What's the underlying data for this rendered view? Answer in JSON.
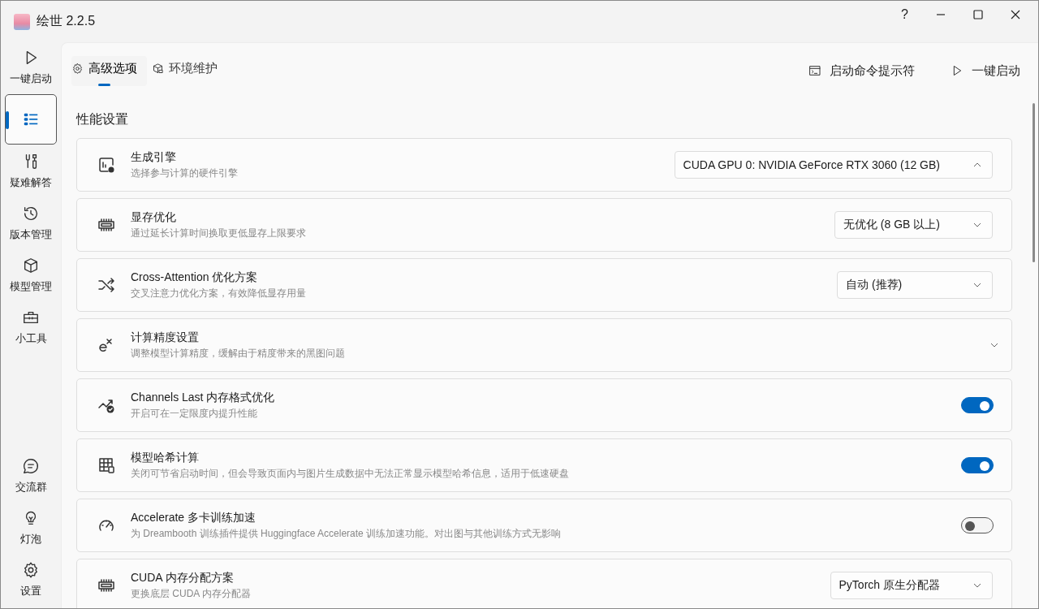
{
  "window": {
    "title": "绘世 2.2.5",
    "controls": [
      "?"
    ]
  },
  "sidebar": {
    "items": [
      {
        "label": "一键启动",
        "selected": false
      },
      {
        "selected": true
      },
      {
        "label": "疑难解答",
        "selected": false
      },
      {
        "label": "版本管理",
        "selected": false
      },
      {
        "label": "模型管理",
        "selected": false
      },
      {
        "label": "小工具",
        "selected": false
      }
    ],
    "bottom_items": [
      {
        "label": "交流群",
        "selected": false
      },
      {
        "label": "灯泡",
        "selected": false
      },
      {
        "label": "设置",
        "selected": false
      }
    ]
  },
  "tabs": [
    {
      "label": "高级选项",
      "selected": true
    },
    {
      "label": "环境维护",
      "selected": false
    }
  ],
  "actions": [
    {
      "label": "启动命令提示符"
    },
    {
      "label": "一键启动"
    }
  ],
  "section_title": "性能设置",
  "settings": [
    {
      "kind": "select",
      "title": "生成引擎",
      "description": "选择参与计算的硬件引擎",
      "value": "CUDA GPU 0: NVIDIA GeForce RTX 3060 (12 GB)",
      "open": true
    },
    {
      "kind": "select",
      "title": "显存优化",
      "description": "通过延长计算时间换取更低显存上限要求",
      "value": "无优化 (8 GB 以上)",
      "open": false
    },
    {
      "kind": "select",
      "title": "Cross-Attention 优化方案",
      "description": "交叉注意力优化方案，有效降低显存用量",
      "value": "自动 (推荐)",
      "open": false
    },
    {
      "kind": "expander",
      "title": "计算精度设置",
      "description": "调整模型计算精度，缓解由于精度带来的黑图问题",
      "expanded": false
    },
    {
      "kind": "toggle",
      "title": "Channels Last 内存格式优化",
      "description": "开启可在一定限度内提升性能",
      "on": true
    },
    {
      "kind": "toggle",
      "title": "模型哈希计算",
      "description": "关闭可节省启动时间，但会导致页面内与图片生成数据中无法正常显示模型哈希信息，适用于低速硬盘",
      "on": true
    },
    {
      "kind": "toggle",
      "title": "Accelerate 多卡训练加速",
      "description": "为 Dreambooth 训练插件提供 Huggingface Accelerate 训练加速功能。对出图与其他训练方式无影响",
      "on": false
    },
    {
      "kind": "select",
      "title": "CUDA 内存分配方案",
      "description": "更换底层 CUDA 内存分配器",
      "value": "PyTorch 原生分配器",
      "open": false
    }
  ]
}
